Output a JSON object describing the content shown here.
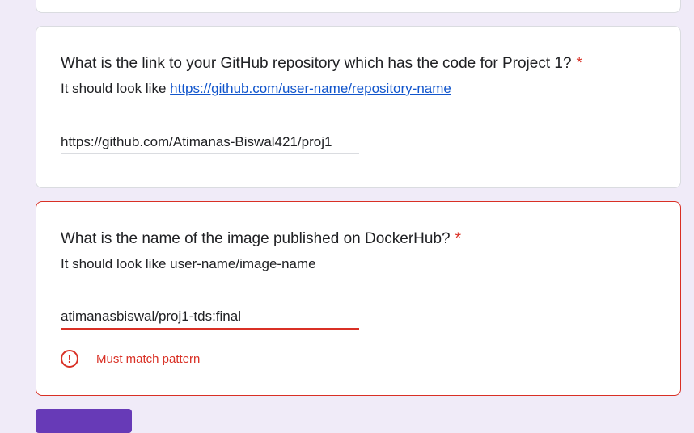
{
  "questions": [
    {
      "title": "What is the link to your GitHub repository which has the code for Project 1?",
      "required_mark": "*",
      "description_prefix": "It should look like ",
      "description_link": "https://github.com/user-name/repository-name",
      "answer": "https://github.com/Atimanas-Biswal421/proj1"
    },
    {
      "title": "What is the name of the image published on DockerHub?",
      "required_mark": "*",
      "description": "It should look like user-name/image-name",
      "answer": "atimanasbiswal/proj1-tds:final",
      "error": "Must match pattern",
      "error_icon": "error-circle-icon"
    }
  ],
  "colors": {
    "background": "#f0ebf8",
    "error": "#d93025",
    "link": "#1155cc",
    "accent": "#673ab7"
  }
}
